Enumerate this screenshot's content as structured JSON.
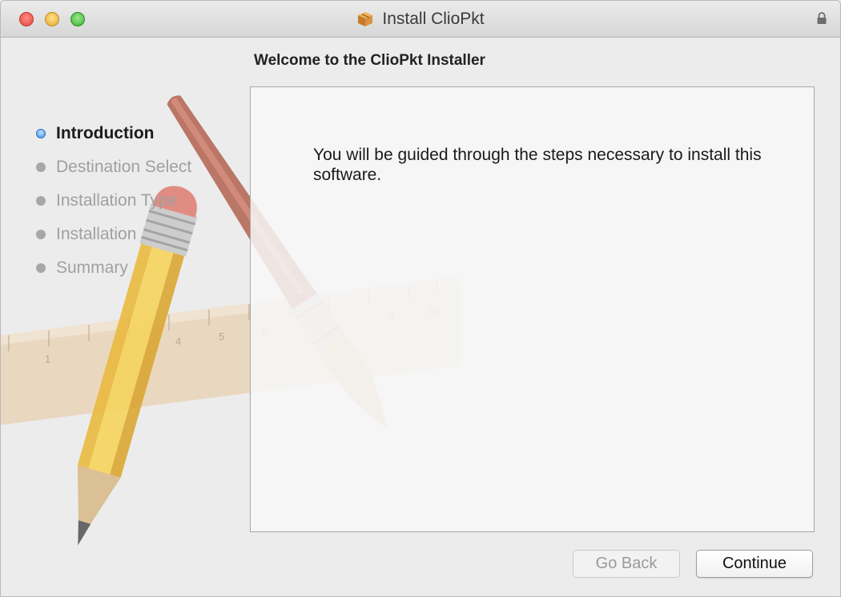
{
  "window": {
    "title": "Install ClioPkt",
    "icon": "package-icon",
    "lock_icon": "lock-icon"
  },
  "heading": "Welcome to the ClioPkt Installer",
  "steps": [
    {
      "label": "Introduction",
      "state": "active"
    },
    {
      "label": "Destination Select",
      "state": "pending"
    },
    {
      "label": "Installation Type",
      "state": "pending"
    },
    {
      "label": "Installation",
      "state": "pending"
    },
    {
      "label": "Summary",
      "state": "pending"
    }
  ],
  "content": {
    "text": "You will be guided through the steps necessary to install this software."
  },
  "buttons": {
    "back": "Go Back",
    "continue": "Continue"
  },
  "colors": {
    "active_step": "#3f8ee6",
    "window_bg": "#ececec"
  }
}
